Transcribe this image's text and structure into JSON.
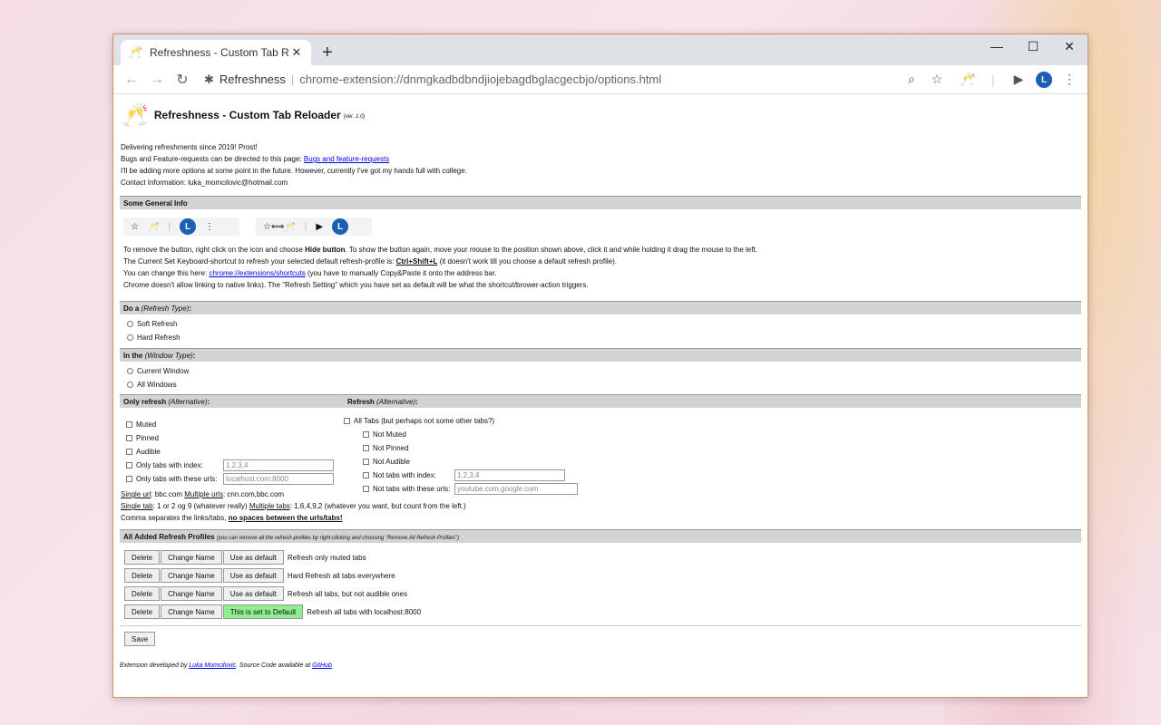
{
  "browser": {
    "tab_title": "Refreshness - Custom Tab Reloader",
    "tab_favicon": "🥂",
    "site_name": "Refreshness",
    "url": "chrome-extension://dnmgkadbdbndjiojebagdbglacgecbjo/options.html",
    "avatar_letter": "L"
  },
  "header": {
    "title": "Refreshness - Custom Tab Reloader",
    "version": "(ver. 1.0)"
  },
  "intro": {
    "line1": "Delivering refreshments since 2019! Prost!",
    "line2_prefix": "Bugs and Feature-requests can be directed to this page: ",
    "line2_link": "Bugs and feature-requests",
    "line3": "I'll be adding more options at some point in the future. However, currently I've got my hands full with college.",
    "line4": "Contact Information: luka_momcilovic@hotmail.com"
  },
  "general": {
    "title": "Some General Info",
    "p1_a": "To remove the button, right click on the icon and choose ",
    "p1_b": "Hide button",
    "p1_c": ". To show the button again, move your mouse to the position shown above, click it and while holding it drag the mouse to the left.",
    "p2_a": "The Current Set Keyboard-shortcut to refresh your selected default refresh-profile is: ",
    "p2_b": "Ctrl+Shift+L",
    "p2_c": " (it doesn't work till you choose a default refresh profile).",
    "p3_a": "You can change this here: ",
    "p3_link": "chrome://extensions/shortcuts",
    "p3_c": " (you have to manually Copy&Paste it onto the address bar.",
    "p4": "Chrome doesn't allow linking to native links). The \"Refresh Setting\" which you have set as default will be what the shortcut/brower-action triggers."
  },
  "refresh_type": {
    "title_bold": "Do a ",
    "title_italic": "(Refresh Type)",
    "title_end": ":",
    "options": [
      "Soft Refresh",
      "Hard Refresh"
    ]
  },
  "window_type": {
    "title_bold": "In the ",
    "title_italic": "(Window Type)",
    "title_end": ":",
    "options": [
      "Current Window",
      "All Windows"
    ]
  },
  "alt": {
    "left_title_bold": "Only refresh ",
    "left_title_italic": "(Alternative)",
    "right_title_bold": "Refresh ",
    "right_title_italic": "(Alternative)",
    "colon": ":",
    "left_opts": [
      "Muted",
      "Pinned",
      "Audible"
    ],
    "left_index_label": "Only tabs with index:",
    "left_index_placeholder": "1,2,3,4",
    "left_urls_label": "Only tabs with these urls:",
    "left_urls_placeholder": "localhost.com:8000",
    "right_all": "All Tabs (but perhaps not some other tabs?)",
    "right_opts": [
      "Not Muted",
      "Not Pinned",
      "Not Audible"
    ],
    "right_index_label": "Not tabs with index:",
    "right_index_placeholder": "1,2,3,4",
    "right_urls_label": "Not tabs with these urls:",
    "right_urls_placeholder": "youtube.com,google.com"
  },
  "notes": {
    "n1_a": "Single url",
    "n1_b": ": bbc.com ",
    "n1_c": "Multiple urls",
    "n1_d": ": cnn.com,bbc.com",
    "n2_a": "Single tab",
    "n2_b": ": 1 or 2 og 9 (whatever really) ",
    "n2_c": "Multiple tabs",
    "n2_d": ": 1,6,4,9,2 (whatever you want, but count from the left.)",
    "n3_a": "Comma separates the links/tabs, ",
    "n3_b": "no spaces between the urls/tabs!"
  },
  "profiles": {
    "title": "All Added Refresh Profiles",
    "subtitle": "(you can remove all the refresh-profiles by right-clicking and choosing \"Remove All Refresh Profiles\")",
    "delete_label": "Delete",
    "change_label": "Change Name",
    "use_default_label": "Use as default",
    "is_default_label": "This is set to Default",
    "rows": [
      {
        "name": "Refresh only muted tabs"
      },
      {
        "name": "Hard Refresh all tabs everywhere"
      },
      {
        "name": "Refresh all tabs, but not audible ones"
      },
      {
        "name": "Refresh all tabs with localhost:8000"
      }
    ]
  },
  "save_label": "Save",
  "footer": {
    "prefix": "Extension developed by ",
    "author": "Luka Momcilovic",
    "mid": ". Source Code available at ",
    "link": "GitHub"
  }
}
